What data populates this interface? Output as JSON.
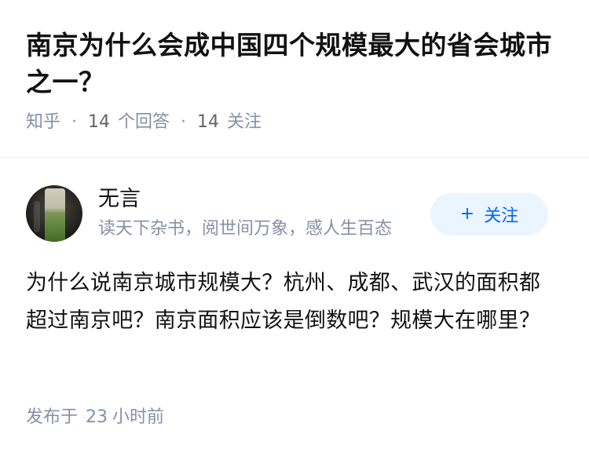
{
  "question": {
    "title": "南京为什么会成中国四个规模最大的省会城市之一？",
    "source": "知乎",
    "answers_count": "14",
    "answers_label": "个回答",
    "follows_count": "14",
    "follows_label": "关注",
    "separator": "·"
  },
  "author": {
    "name": "无言",
    "bio": "读天下杂书，阅世间万象，感人生百态",
    "follow_button": {
      "icon": "plus-icon",
      "icon_glyph": "+",
      "label": "关注",
      "color": "#0066ff",
      "background": "#ebf5ff"
    }
  },
  "answer": {
    "text": "为什么说南京城市规模大？杭州、成都、武汉的面积都超过南京吧？南京面积应该是倒数吧？规模大在哪里？"
  },
  "footer": {
    "published_label": "发布于",
    "time_value": "23",
    "time_unit": "小时前"
  }
}
